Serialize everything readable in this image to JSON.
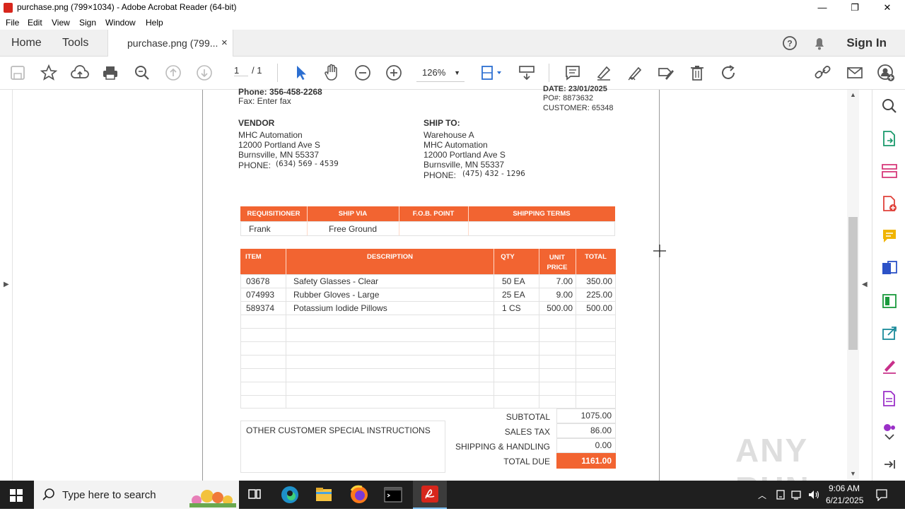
{
  "window": {
    "title": "purchase.png (799×1034) - Adobe Acrobat Reader (64-bit)",
    "minimize": "—",
    "maximize": "❐",
    "close": "✕"
  },
  "menu": [
    "File",
    "Edit",
    "View",
    "Sign",
    "Window",
    "Help"
  ],
  "tabs": {
    "home": "Home",
    "tools": "Tools",
    "document": "purchase.png (799...",
    "close": "×",
    "sign_in": "Sign In"
  },
  "toolbar": {
    "page_current": "1",
    "page_total": "/ 1",
    "zoom": "126%"
  },
  "document": {
    "top_left": {
      "phone": "Phone: 356-458-2268",
      "fax": "Fax: Enter fax"
    },
    "top_right": {
      "date": "DATE: 23/01/2025",
      "po": "PO#: 8873632",
      "customer": "CUSTOMER: 65348"
    },
    "vendor": {
      "heading": "VENDOR",
      "lines": [
        "MHC Automation",
        "12000 Portland Ave S",
        "Burnsville, MN 55337"
      ],
      "phone_label": "PHONE:",
      "phone_value": "(634) 569 - 4539"
    },
    "ship_to": {
      "heading": "SHIP TO:",
      "lines": [
        "Warehouse A",
        "MHC Automation",
        "12000 Portland Ave S",
        "Burnsville, MN 55337"
      ],
      "phone_label": "PHONE:",
      "phone_value": "(475) 432 - 1296"
    },
    "shipping_table": {
      "headers": [
        "REQUISITIONER",
        "SHIP VIA",
        "F.O.B. POINT",
        "SHIPPING TERMS"
      ],
      "row": [
        "Frank",
        "Free Ground",
        "",
        ""
      ]
    },
    "items_table": {
      "headers": [
        "ITEM",
        "DESCRIPTION",
        "QTY",
        "UNIT PRICE",
        "TOTAL"
      ],
      "rows": [
        [
          "03678",
          "Safety Glasses - Clear",
          "50 EA",
          "7.00",
          "350.00"
        ],
        [
          "074993",
          "Rubber Gloves - Large",
          "25 EA",
          "9.00",
          "225.00"
        ],
        [
          "589374",
          "Potassium Iodide Pillows",
          "1 CS",
          "500.00",
          "500.00"
        ]
      ]
    },
    "instructions_label": "OTHER CUSTOMER SPECIAL INSTRUCTIONS",
    "totals": {
      "subtotal_label": "SUBTOTAL",
      "subtotal": "1075.00",
      "tax_label": "SALES TAX",
      "tax": "86.00",
      "shipping_label": "SHIPPING & HANDLING",
      "shipping": "0.00",
      "due_label": "TOTAL DUE",
      "due": "1161.00"
    }
  },
  "watermark": "ANY RUN",
  "taskbar": {
    "search_placeholder": "Type here to search",
    "time": "9:06 AM",
    "date": "6/21/2025"
  },
  "colors": {
    "accent_orange": "#f26431",
    "acrobat_red": "#d7261c",
    "toolbar_blue": "#2c6fd1"
  }
}
